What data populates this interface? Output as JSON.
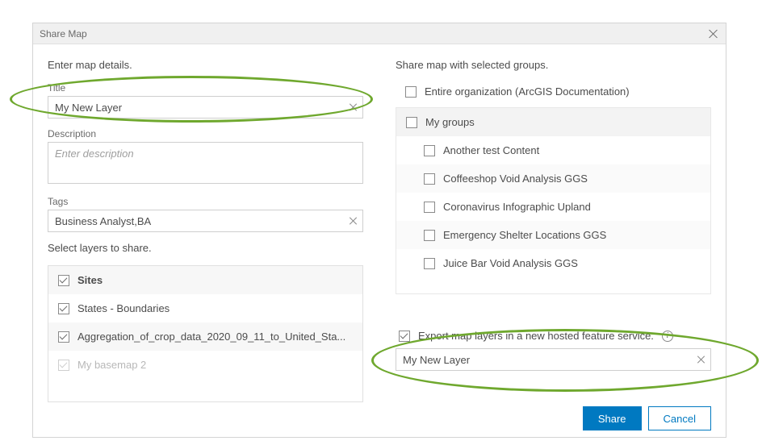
{
  "dialog": {
    "title": "Share Map"
  },
  "left": {
    "header": "Enter map details.",
    "title_label": "Title",
    "title_value": "My New Layer",
    "desc_label": "Description",
    "desc_placeholder": "Enter description",
    "tags_label": "Tags",
    "tags_value": "Business Analyst,BA",
    "layers_header": "Select layers to share.",
    "layers": [
      {
        "label": "Sites",
        "checked": true,
        "bold": true,
        "alt": true,
        "disabled": false
      },
      {
        "label": "States - Boundaries",
        "checked": true,
        "bold": false,
        "alt": false,
        "disabled": false
      },
      {
        "label": "Aggregation_of_crop_data_2020_09_11_to_United_Sta...",
        "checked": true,
        "bold": false,
        "alt": true,
        "disabled": false
      },
      {
        "label": "My basemap 2",
        "checked": true,
        "bold": false,
        "alt": false,
        "disabled": true
      }
    ]
  },
  "right": {
    "header": "Share map with selected groups.",
    "org_label": "Entire organization (ArcGIS Documentation)",
    "groups_label": "My groups",
    "groups": [
      {
        "label": "Another test Content",
        "alt": false
      },
      {
        "label": "Coffeeshop Void Analysis GGS",
        "alt": true
      },
      {
        "label": "Coronavirus Infographic Upland",
        "alt": false
      },
      {
        "label": "Emergency Shelter Locations GGS",
        "alt": true
      },
      {
        "label": "Juice Bar Void Analysis GGS",
        "alt": false
      }
    ],
    "export_label": "Export map layers in a new hosted feature service.",
    "export_value": "My New Layer"
  },
  "footer": {
    "share": "Share",
    "cancel": "Cancel"
  }
}
